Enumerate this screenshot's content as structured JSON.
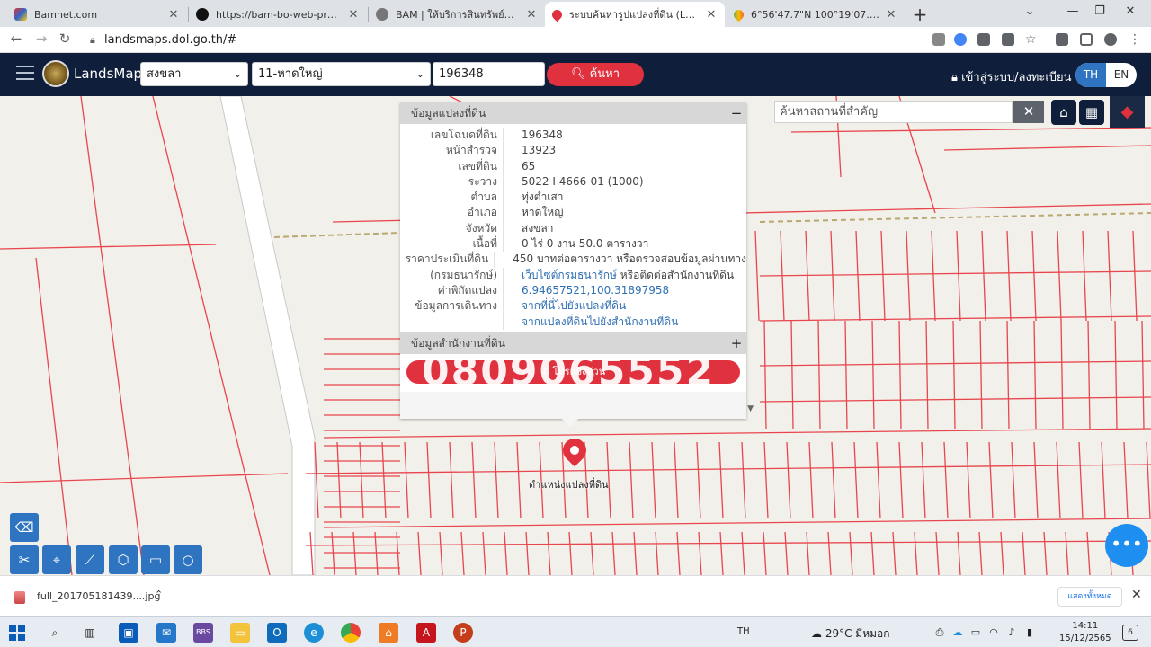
{
  "browser": {
    "tabs": [
      {
        "label": "Bamnet.com",
        "color": "#d33"
      },
      {
        "label": "https://bam-bo-web-prd.bam.co",
        "color": "#111"
      },
      {
        "label": "BAM | ให้บริการสินทรัพย์ด้านอสังหาริ",
        "color": "#666"
      },
      {
        "label": "ระบบค้นหารูปแปลงที่ดิน (LandsMaps",
        "color": "#e0313f"
      },
      {
        "label": "6°56'47.7\"N 100°19'07.7\"E - Goo",
        "color": "#34a853"
      }
    ],
    "url": "landsmaps.dol.go.th/#"
  },
  "header": {
    "brand": "LandsMaps",
    "province": "สงขลา",
    "district": "11-หาดใหญ่",
    "parcel_no": "196348",
    "search_label": "ค้นหา",
    "login_label": "เข้าสู่ระบบ/ลงทะเบียน",
    "lang_th": "TH",
    "lang_en": "EN"
  },
  "panel": {
    "title": "ข้อมูลแปลงที่ดิน",
    "collapse_symbol": "−",
    "rows": [
      {
        "k": "เลขโฉนดที่ดิน",
        "v": "196348"
      },
      {
        "k": "หน้าสำรวจ",
        "v": "13923"
      },
      {
        "k": "เลขที่ดิน",
        "v": "65"
      },
      {
        "k": "ระวาง",
        "v": "5022 I 4666-01 (1000)"
      },
      {
        "k": "ตำบล",
        "v": "ทุ่งตำเสา"
      },
      {
        "k": "อำเภอ",
        "v": "หาดใหญ่"
      },
      {
        "k": "จังหวัด",
        "v": "สงขลา"
      },
      {
        "k": "เนื้อที่",
        "v": "0 ไร่ 0 งาน 50.0 ตารางวา"
      },
      {
        "k": "ราคาประเมินที่ดิน",
        "v": "450 บาทต่อตารางวา หรือตรวจสอบข้อมูลผ่านทาง"
      },
      {
        "k": "(กรมธนารักษ์)",
        "v_link": "เว็บไซต์กรมธนารักษ์",
        "v_rest": " หรือติดต่อสำนักงานที่ดิน"
      },
      {
        "k": "ค่าพิกัดแปลง",
        "v_link": "6.94657521,100.31897958"
      },
      {
        "k": "ข้อมูลการเดินทาง",
        "v_link": "จากที่นี่ไปยังแปลงที่ดิน"
      },
      {
        "k": "",
        "v_link": "จากแปลงที่ดินไปยังสำนักงานที่ดิน"
      }
    ],
    "office_title": "ข้อมูลสำนักงานที่ดิน",
    "expand_symbol": "+",
    "call_label": "โทรแจ้งด่วน",
    "phone_watermark": "0809065552"
  },
  "map": {
    "place_search_placeholder": "ค้นหาสถานที่สำคัญ",
    "marker_label": "ตำแหน่งแปลงที่ดิน"
  },
  "downloads": {
    "filename": "full_201705181439....jpg",
    "show_all": "แสดงทั้งหมด"
  },
  "taskbar": {
    "lang": "TH",
    "weather": "29°C มีหมอก",
    "time": "14:11",
    "date": "15/12/2565",
    "notifications": "6"
  }
}
